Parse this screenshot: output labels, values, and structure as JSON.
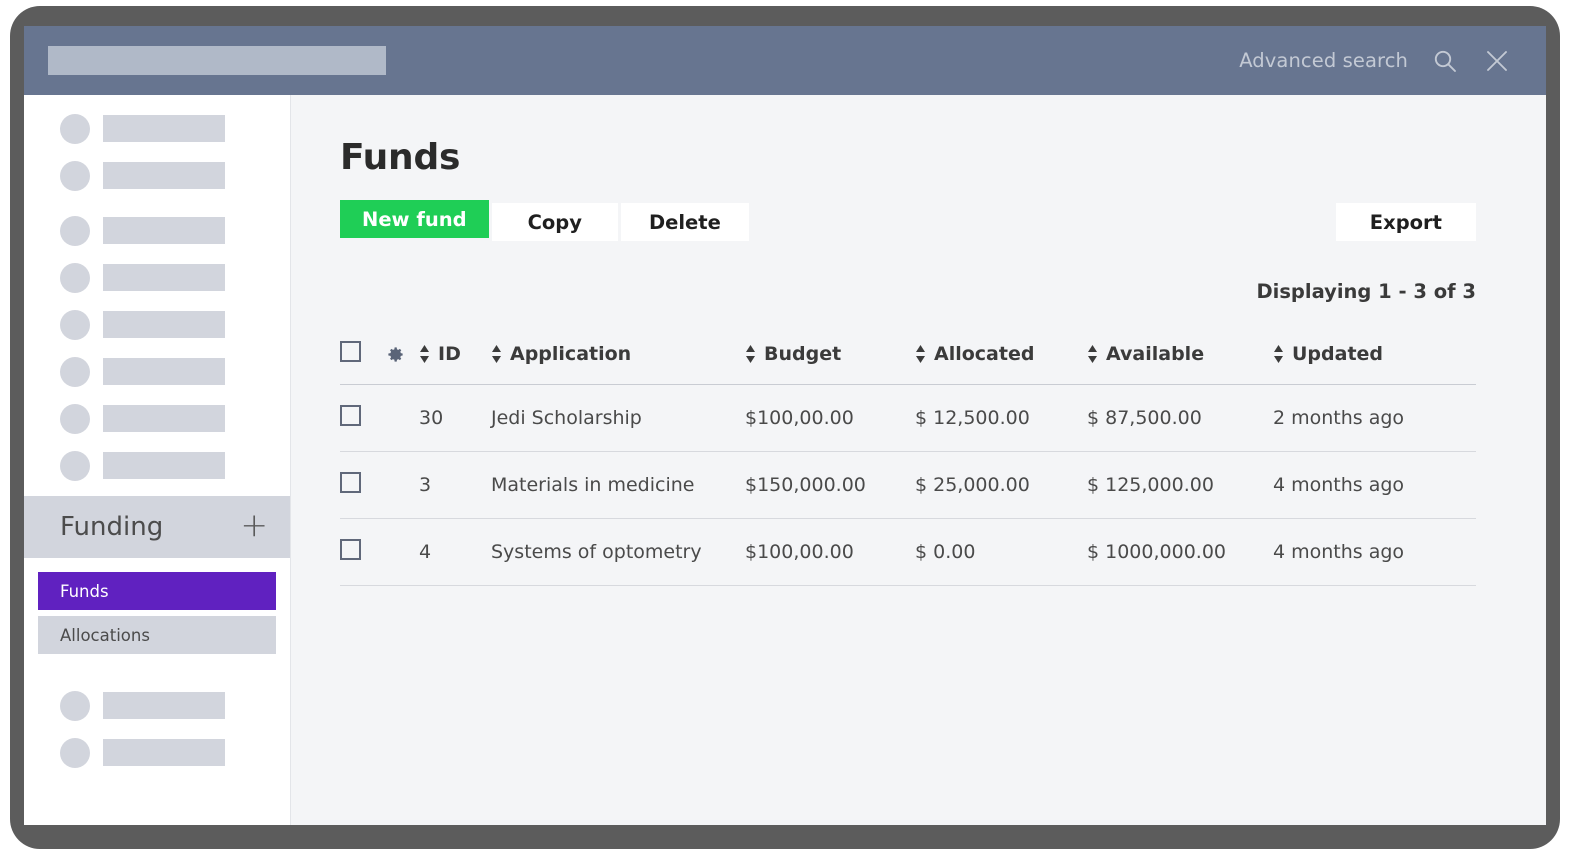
{
  "topbar": {
    "search_placeholder": "",
    "search_value": "",
    "advanced_search_label": "Advanced search",
    "search_icon": "search-icon",
    "close_icon": "close-icon"
  },
  "sidebar": {
    "skeleton_top_count": 8,
    "skeleton_bottom_count": 2,
    "section": {
      "title": "Funding",
      "add_label": "+"
    },
    "nav_items": [
      {
        "label": "Funds",
        "state": "active"
      },
      {
        "label": "Allocations",
        "state": "plain"
      }
    ]
  },
  "main": {
    "page_title": "Funds",
    "buttons": {
      "new_fund": "New fund",
      "copy": "Copy",
      "delete": "Delete",
      "export": "Export"
    },
    "displaying": "Displaying 1 - 3 of 3",
    "table": {
      "columns": [
        {
          "key": "check",
          "label": "",
          "sortable": false
        },
        {
          "key": "gear",
          "label": "",
          "sortable": false
        },
        {
          "key": "id",
          "label": "ID",
          "sortable": true
        },
        {
          "key": "application",
          "label": "Application",
          "sortable": true
        },
        {
          "key": "budget",
          "label": "Budget",
          "sortable": true
        },
        {
          "key": "allocated",
          "label": "Allocated",
          "sortable": true
        },
        {
          "key": "available",
          "label": "Available",
          "sortable": true
        },
        {
          "key": "updated",
          "label": "Updated",
          "sortable": true
        }
      ],
      "rows": [
        {
          "id": "30",
          "application": "Jedi Scholarship",
          "budget": "$100,00.00",
          "allocated": "$ 12,500.00",
          "available": "$ 87,500.00",
          "updated": "2 months ago",
          "checked": false
        },
        {
          "id": "3",
          "application": "Materials in medicine",
          "budget": "$150,000.00",
          "allocated": "$ 25,000.00",
          "available": "$ 125,000.00",
          "updated": "4 months ago",
          "checked": false
        },
        {
          "id": "4",
          "application": "Systems of optometry",
          "budget": "$100,00.00",
          "allocated": "$ 0.00",
          "available": "$ 1000,000.00",
          "updated": "4 months ago",
          "checked": false
        }
      ]
    }
  },
  "colors": {
    "frame": "#5c5c5c",
    "topbar": "#677590",
    "primary_green": "#1fce56",
    "active_purple": "#6021c0",
    "skeleton_gray": "#d2d5dd",
    "content_bg": "#f4f5f7"
  }
}
